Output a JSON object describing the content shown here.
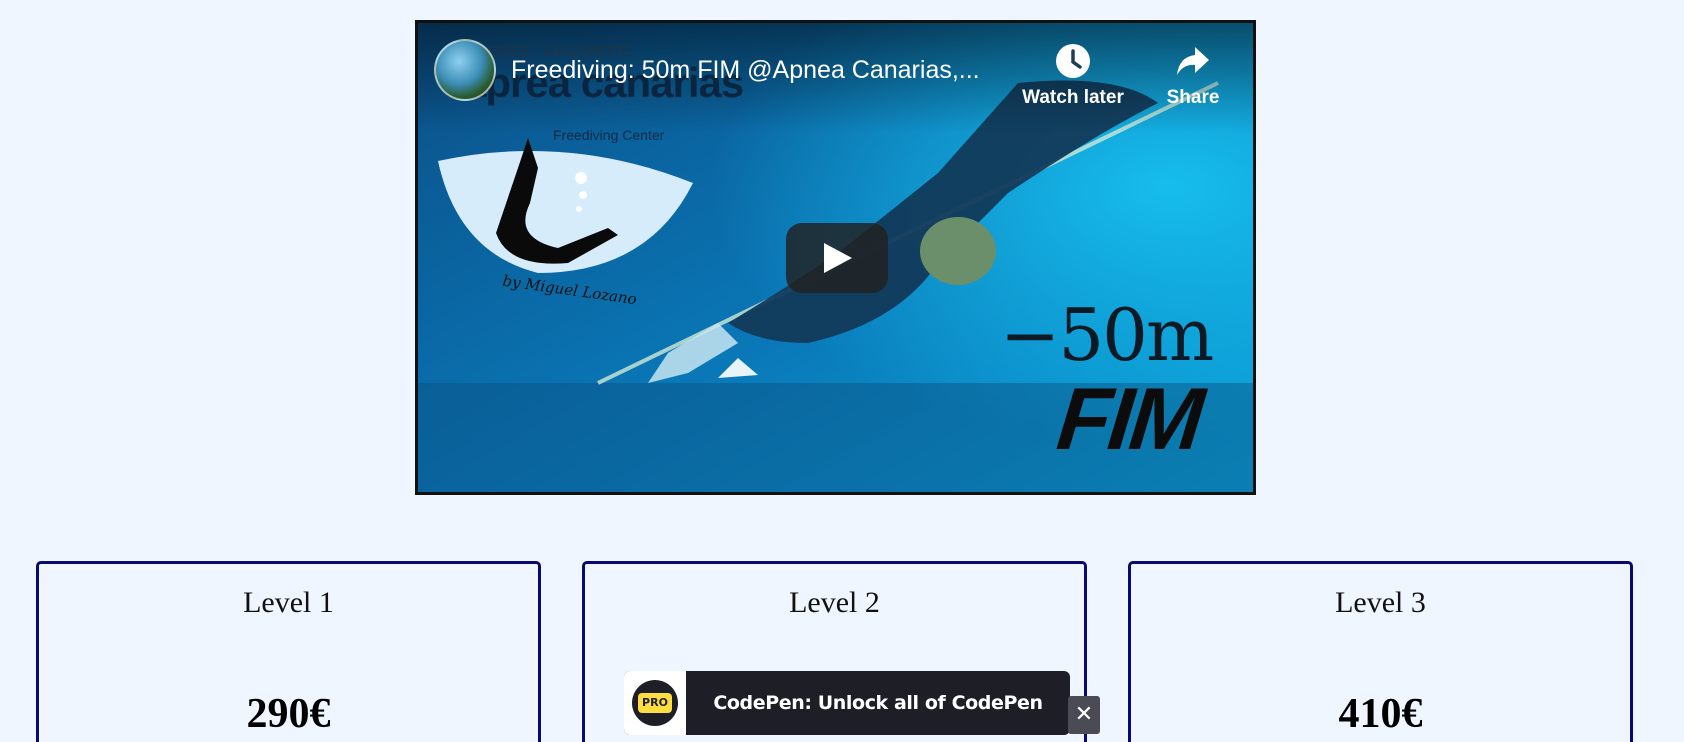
{
  "video": {
    "title": "Freediving: 50m FIM @Apnea Canarias,...",
    "logo_strip": "ERIFE · LANZAROTE",
    "logo_big": "aprea canarias",
    "logo_sub": "Freediving Center",
    "logo_sign": "by Miguel Lozano",
    "overlay_depth": "−50m",
    "overlay_discipline": "FIM",
    "actions": {
      "watch_later": {
        "label": "Watch later",
        "icon": "clock-icon"
      },
      "share": {
        "label": "Share",
        "icon": "share-arrow-icon"
      }
    },
    "play_icon": "play-icon"
  },
  "cards": [
    {
      "level": "Level 1",
      "price": "290€"
    },
    {
      "level": "Level 2",
      "price": ""
    },
    {
      "level": "Level 3",
      "price": "410€"
    }
  ],
  "toast": {
    "badge": "PRO",
    "text": "CodePen: Unlock all of CodePen",
    "close_icon": "close-icon",
    "close_glyph": "✕"
  },
  "colors": {
    "page_background": "#eff6ff",
    "card_border": "#0a0a6e",
    "toast_background": "#1e1f26",
    "pro_badge": "#ffdd40"
  }
}
